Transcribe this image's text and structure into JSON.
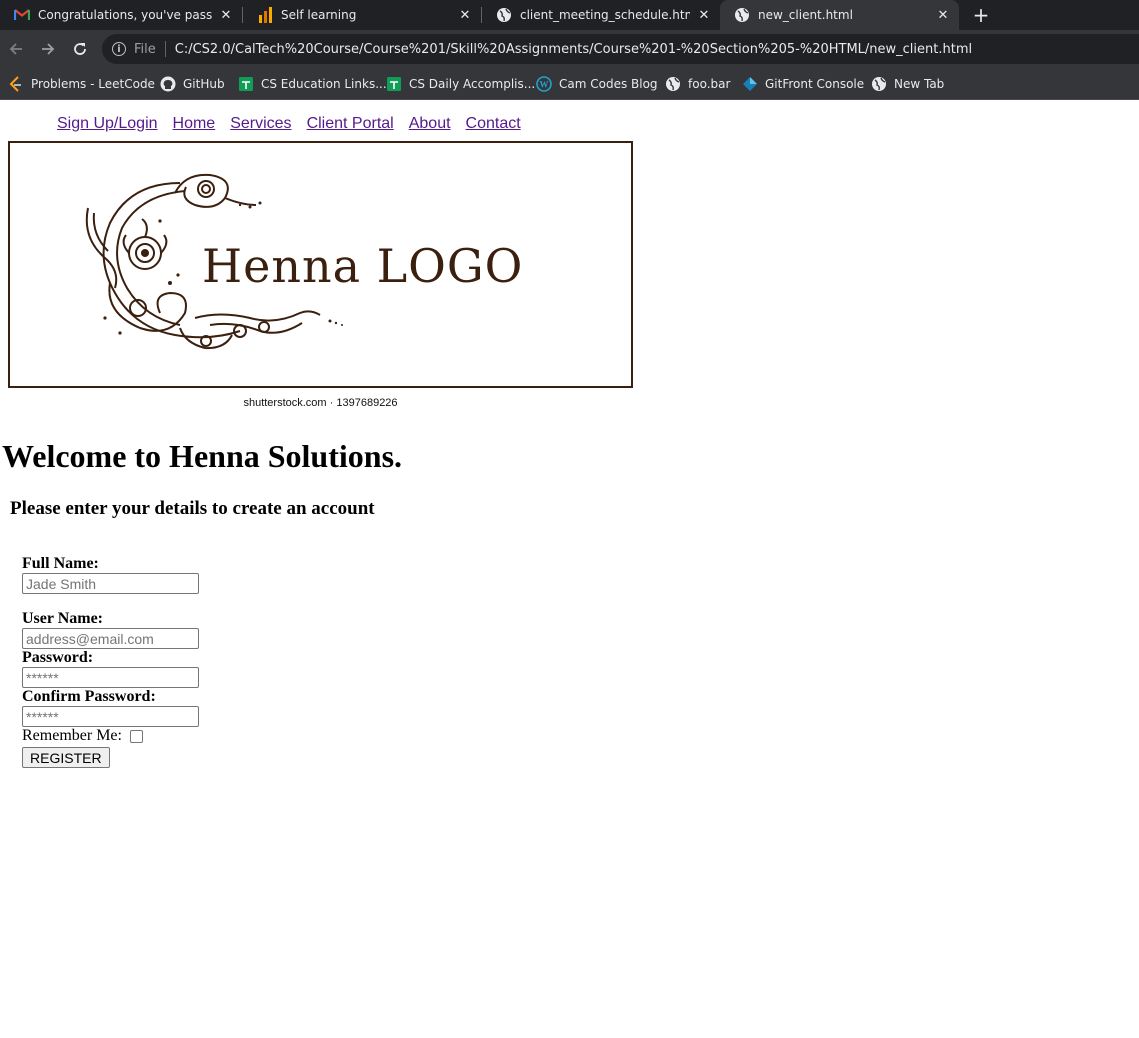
{
  "browser": {
    "tabs": [
      {
        "title": "Congratulations, you've passed y",
        "icon": "gmail-icon",
        "active": false
      },
      {
        "title": "Self learning",
        "icon": "analytics-icon",
        "active": false
      },
      {
        "title": "client_meeting_schedule.html",
        "icon": "globe-icon",
        "active": false
      },
      {
        "title": "new_client.html",
        "icon": "globe-icon",
        "active": true
      }
    ],
    "address": {
      "scheme": "File",
      "url": "C:/CS2.0/CalTech%20Course/Course%201/Skill%20Assignments/Course%201-%20Section%205-%20HTML/new_client.html"
    },
    "bookmarks": [
      {
        "label": "Problems - LeetCode",
        "icon": "leetcode-icon"
      },
      {
        "label": "GitHub",
        "icon": "github-icon"
      },
      {
        "label": "CS Education Links...",
        "icon": "sheets-icon"
      },
      {
        "label": "CS Daily Accomplis...",
        "icon": "sheets-icon"
      },
      {
        "label": "Cam Codes Blog",
        "icon": "wordpress-icon"
      },
      {
        "label": "foo.bar",
        "icon": "globe-icon"
      },
      {
        "label": "GitFront Console",
        "icon": "gitfront-icon"
      },
      {
        "label": "New Tab",
        "icon": "globe-icon"
      }
    ]
  },
  "nav": {
    "links": [
      "Sign Up/Login",
      "Home",
      "Services",
      "Client Portal",
      "About",
      "Contact"
    ],
    "link_color": "#551a8b"
  },
  "logo": {
    "text": "Henna LOGO",
    "credit": "shutterstock.com · 1397689226",
    "color": "#3b200f"
  },
  "content": {
    "heading": "Welcome to Henna Solutions.",
    "subheading": "Please enter your details to create an account"
  },
  "form": {
    "full_name_label": "Full Name:",
    "full_name_placeholder": "Jade Smith",
    "user_name_label": "User Name:",
    "user_name_placeholder": "address@email.com",
    "password_label": "Password:",
    "password_placeholder": "******",
    "confirm_label": "Confirm Password:",
    "confirm_placeholder": "******",
    "remember_label": "Remember Me:",
    "register_label": "REGISTER"
  }
}
